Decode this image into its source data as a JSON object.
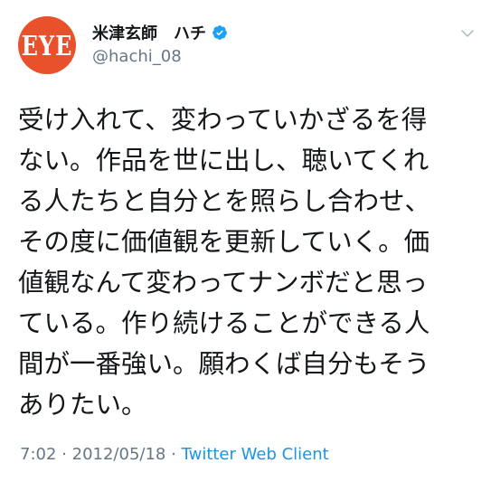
{
  "tweet": {
    "avatar": {
      "text": "EYE",
      "color": "#e9502c"
    },
    "author": {
      "display_name": "米津玄師　ハチ",
      "handle": "@hachi_08",
      "verified": true
    },
    "menu_icon": "chevron-down-icon",
    "body_lines": [
      "受け入れて、変わっていかざるを得",
      "ない。作品を世に出し、聴いてくれ",
      "る人たちと自分とを照らし合わせ、",
      "その度に価値観を更新していく。価",
      "値観なんて変わってナンボだと思っ",
      "ている。作り続けることができる人",
      "間が一番強い。願わくば自分もそう",
      "ありたい。"
    ],
    "time": "7:02",
    "separator": "·",
    "date": "2012/05/18",
    "source": "Twitter Web Client"
  },
  "colors": {
    "text": "#14171a",
    "secondary": "#657786",
    "link": "#1b95e0",
    "verified": "#1da1f2"
  }
}
